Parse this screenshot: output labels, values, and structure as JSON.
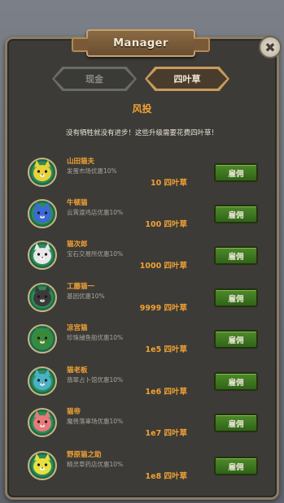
{
  "window": {
    "title": "Manager",
    "close_label": "✖"
  },
  "tabs": [
    {
      "label": "现金",
      "active": false
    },
    {
      "label": "四叶草",
      "active": true
    }
  ],
  "section": {
    "title": "风投",
    "subtitle": "没有牺牲就没有进步！这些升级需要花费四叶草！"
  },
  "managers": [
    {
      "name": "山田猫夫",
      "desc": "发蛋市场优惠10%",
      "cost": "10 四叶草",
      "hire_label": "雇佣",
      "color": "#e8d23a"
    },
    {
      "name": "牛顿猫",
      "desc": "云霄渡鸡店优惠10%",
      "cost": "100 四叶草",
      "hire_label": "雇佣",
      "color": "#3a6ad6"
    },
    {
      "name": "猫次郎",
      "desc": "宝石交易所优惠10%",
      "cost": "1000 四叶草",
      "hire_label": "雇佣",
      "color": "#e8e8e8"
    },
    {
      "name": "工藤猫一",
      "desc": "基因优惠10%",
      "cost": "9999 四叶草",
      "hire_label": "雇佣",
      "color": "#3a3a3a"
    },
    {
      "name": "凉宫猫",
      "desc": "珍珠捕鱼船优惠10%",
      "cost": "1e5 四叶草",
      "hire_label": "雇佣",
      "color": "#3a8a34"
    },
    {
      "name": "猫老板",
      "desc": "翡翠占卜馆优惠10%",
      "cost": "1e6 四叶草",
      "hire_label": "雇佣",
      "color": "#4ab2c8"
    },
    {
      "name": "猫帝",
      "desc": "魔兽落辜场优惠10%",
      "cost": "1e7 四叶草",
      "hire_label": "雇佣",
      "color": "#e87a7a"
    },
    {
      "name": "野原猫之助",
      "desc": "精灵草药店优惠10%",
      "cost": "1e8 四叶草",
      "hire_label": "雇佣",
      "color": "#e8e040"
    }
  ]
}
